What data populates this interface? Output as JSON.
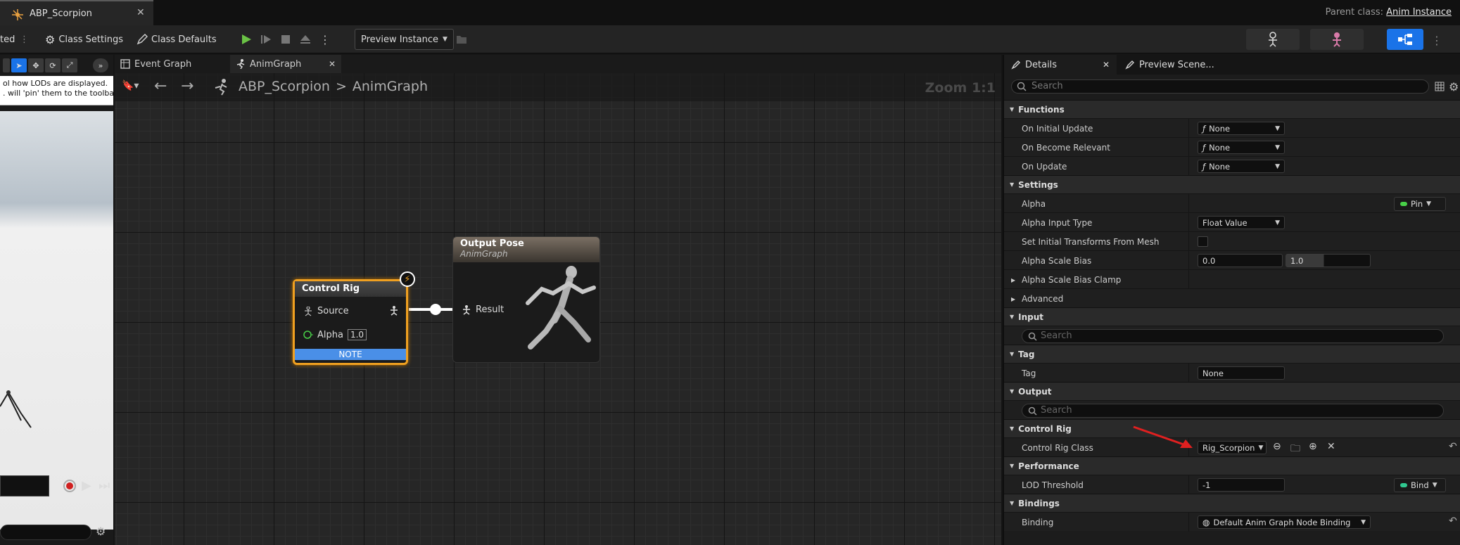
{
  "titlebar": {
    "doc_tab": "ABP_Scorpion",
    "parent_label": "Parent class:",
    "parent_value": "Anim Instance"
  },
  "toolbar": {
    "cut_text": "ted",
    "class_settings": "Class Settings",
    "class_defaults": "Class Defaults",
    "preview_instance": "Preview Instance"
  },
  "viewport": {
    "tip_line1": "ol how LODs are displayed.",
    "tip_line2": ". will 'pin' them to the toolbar."
  },
  "graph": {
    "tabs": [
      {
        "label": "Event Graph"
      },
      {
        "label": "AnimGraph"
      }
    ],
    "breadcrumb": {
      "root": "ABP_Scorpion",
      "sep": ">",
      "current": "AnimGraph"
    },
    "zoom": "Zoom 1:1",
    "control_rig_node": {
      "title": "Control Rig",
      "source": "Source",
      "alpha": "Alpha",
      "alpha_value": "1.0",
      "note": "NOTE"
    },
    "output_pose_node": {
      "title": "Output Pose",
      "subtitle": "AnimGraph",
      "result": "Result"
    }
  },
  "details": {
    "tabs": [
      {
        "label": "Details"
      },
      {
        "label": "Preview Scene..."
      }
    ],
    "search_placeholder": "Search",
    "sections": {
      "functions": "Functions",
      "settings": "Settings",
      "input": "Input",
      "tag": "Tag",
      "output": "Output",
      "control_rig": "Control Rig",
      "performance": "Performance",
      "bindings": "Bindings"
    },
    "rows": {
      "on_initial_update": {
        "label": "On Initial Update",
        "value": "None"
      },
      "on_become_relevant": {
        "label": "On Become Relevant",
        "value": "None"
      },
      "on_update": {
        "label": "On Update",
        "value": "None"
      },
      "alpha": {
        "label": "Alpha",
        "pin": "Pin"
      },
      "alpha_input_type": {
        "label": "Alpha Input Type",
        "value": "Float Value"
      },
      "set_initial_transforms": {
        "label": "Set Initial Transforms From Mesh"
      },
      "alpha_scale_bias": {
        "label": "Alpha Scale Bias",
        "min": "0.0",
        "max": "1.0"
      },
      "alpha_scale_bias_clamp": {
        "label": "Alpha Scale Bias Clamp"
      },
      "advanced": {
        "label": "Advanced"
      },
      "input_search": "Search",
      "tag": {
        "label": "Tag",
        "value": "None"
      },
      "output_search": "Search",
      "control_rig_class": {
        "label": "Control Rig Class",
        "value": "Rig_Scorpion"
      },
      "lod_threshold": {
        "label": "LOD Threshold",
        "value": "-1",
        "bind": "Bind"
      },
      "binding": {
        "label": "Binding",
        "value": "Default Anim Graph Node Binding"
      }
    }
  },
  "colors": {
    "accent_orange": "#f0a020",
    "note_blue": "#4a8fe7",
    "arrow_red": "#e02020",
    "pin_green": "#48d048"
  }
}
